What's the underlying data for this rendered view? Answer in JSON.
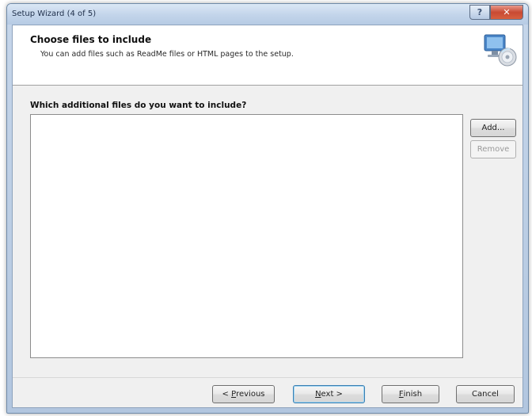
{
  "window": {
    "title": "Setup Wizard (4 of 5)",
    "caption": {
      "help_glyph": "?",
      "close_glyph": "✕"
    }
  },
  "header": {
    "title": "Choose files to include",
    "subtitle": "You can add files such as ReadMe files or HTML pages to the setup.",
    "icon": "setup-computer-icon"
  },
  "main": {
    "question": "Which additional files do you want to include?",
    "files": []
  },
  "side_buttons": {
    "add": "Add...",
    "remove": "Remove"
  },
  "footer": {
    "previous": {
      "prefix": "< ",
      "mnemonic": "P",
      "rest": "revious"
    },
    "next": {
      "mnemonic": "N",
      "rest": "ext >"
    },
    "finish": {
      "mnemonic": "F",
      "rest": "inish"
    },
    "cancel": "Cancel"
  },
  "colors": {
    "close_button": "#c84a33",
    "default_button_border": "#3c7fb1",
    "titlebar": "#c2d4ea"
  }
}
